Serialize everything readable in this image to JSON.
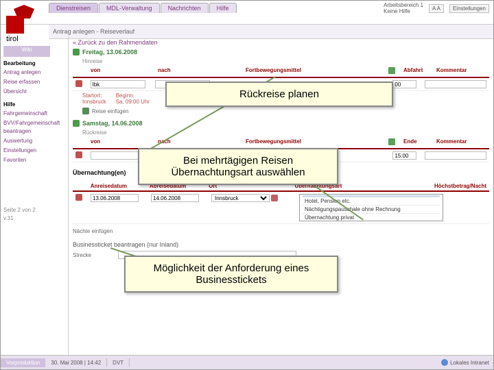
{
  "logo_text": "tirol",
  "tabs": [
    "Dienstreisen",
    "MDL-Verwaltung",
    "Nachrichten",
    "Hilfe"
  ],
  "topright": {
    "workspace": "Arbeitsbereich 1",
    "hint": "Keine Hilfe",
    "accessibility": "A A",
    "settings": "Einstellungen"
  },
  "subbar": "Antrag anlegen - Reiseverlauf",
  "nav_title": "Wiki",
  "sidebar": {
    "groups": [
      {
        "header": "Bearbeitung",
        "items": [
          "Antrag anlegen",
          "Reise erfassen",
          "Übersicht"
        ]
      },
      {
        "header": "Hilfe",
        "items": [
          "Fahrgemeinschaft",
          "BVV/Fahrgemeinschaft beantragen"
        ]
      },
      {
        "header": "",
        "items": [
          "Auswertung",
          "Einstellungen",
          "Favoriten"
        ]
      }
    ],
    "footnote": "Seite 2 von 2\nv.31"
  },
  "backlink": "« Zurück zu den Rahmendaten",
  "day1": {
    "date": "Freitag, 13.06.2008",
    "section": "Hinreise"
  },
  "headers": {
    "von": "von",
    "nach": "nach",
    "fort": "Fortbewegungsmittel",
    "abfahrt": "Abfahrt",
    "kommentar": "Kommentar"
  },
  "row1": {
    "von": "Ibk",
    "nach": "",
    "time": "00"
  },
  "startinfo": {
    "label": "Startort:\nInnsbruck",
    "detail": "Beginn:\nSa, 09:00 Uhr"
  },
  "addlabel": "Reise einfügen",
  "day2": {
    "date": "Samstag, 14.06.2008",
    "section": "Rückreise"
  },
  "headers2": {
    "von": "von",
    "nach": "nach",
    "fort": "Fortbewegungsmittel",
    "ende": "Ende",
    "kommentar": "Kommentar"
  },
  "row2": {
    "time": "15:00"
  },
  "overnight_title": "Übernachtung(en)",
  "ovhdr": {
    "anreise": "Anreisedatum",
    "abreise": "Abreisedatum",
    "ort": "Ort",
    "uart": "Übernachtungsart",
    "hb": "Höchstbetrag/Nacht"
  },
  "ovrow": {
    "anreise": "13.06.2008",
    "abreise": "14.06.2008",
    "ort": "Innsbruck"
  },
  "uart_options": [
    "",
    "Hotel, Pension etc.",
    "Nächtigungspauschale ohne Rechnung",
    "Übernachtung privat"
  ],
  "nact_label": "Nächte einfügen",
  "biz_title": "Businessticket beantragen (nur Inland)",
  "biz_field": "Strecke",
  "callout1": "Rückreise planen",
  "callout2_l1": "Bei mehrtägigen Reisen",
  "callout2_l2": "Übernachtungsart auswählen",
  "callout3_l1": "Möglichkeit der Anforderung eines",
  "callout3_l2": "Businesstickets",
  "footer": {
    "vp": "Vorproduktion",
    "date": "30. Mai 2008 | 14:42",
    "dvt": "DVT",
    "intranet": "Lokales Intranet"
  }
}
